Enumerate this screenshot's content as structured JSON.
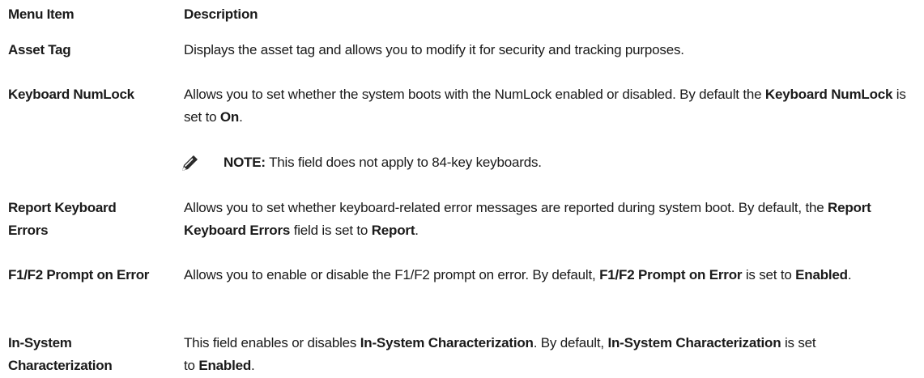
{
  "table": {
    "header": {
      "menu_item": "Menu Item",
      "description": "Description"
    },
    "rows": [
      {
        "item": "Asset Tag",
        "desc": [
          {
            "t": "Displays the asset tag and allows you to modify it for security and tracking purposes."
          }
        ]
      },
      {
        "item": "Keyboard NumLock",
        "desc": [
          {
            "t": "Allows you to set whether the system boots with the NumLock enabled or disabled. By default the "
          },
          {
            "t": "Keyboard NumLock",
            "b": true
          },
          {
            "t": " is set to "
          },
          {
            "t": "On",
            "b": true
          },
          {
            "t": "."
          }
        ],
        "note": {
          "label": "NOTE:",
          "text": " This field does not apply to 84-key keyboards."
        }
      },
      {
        "item": "Report Keyboard Errors",
        "desc": [
          {
            "t": "Allows you to set whether keyboard-related error messages are reported during system boot. By default, the "
          },
          {
            "t": "Report Keyboard Errors",
            "b": true
          },
          {
            "t": " field is set to "
          },
          {
            "t": "Report",
            "b": true
          },
          {
            "t": "."
          }
        ]
      },
      {
        "item": "F1/F2 Prompt on Error",
        "desc": [
          {
            "t": "Allows you to enable or disable the F1/F2 prompt on error. By default, "
          },
          {
            "t": "F1/F2 Prompt on Error",
            "b": true
          },
          {
            "t": " is set to "
          },
          {
            "t": "Enabled",
            "b": true
          },
          {
            "t": "."
          }
        ]
      },
      {
        "item": "In-System Characterization",
        "desc": [
          {
            "t": "This field enables or disables "
          },
          {
            "t": "In-System Characterization",
            "b": true
          },
          {
            "t": ". By default, "
          },
          {
            "t": "In-System Characterization",
            "b": true
          },
          {
            "t": " is set to "
          },
          {
            "t": "Enabled",
            "b": true
          },
          {
            "t": "."
          }
        ]
      }
    ]
  }
}
